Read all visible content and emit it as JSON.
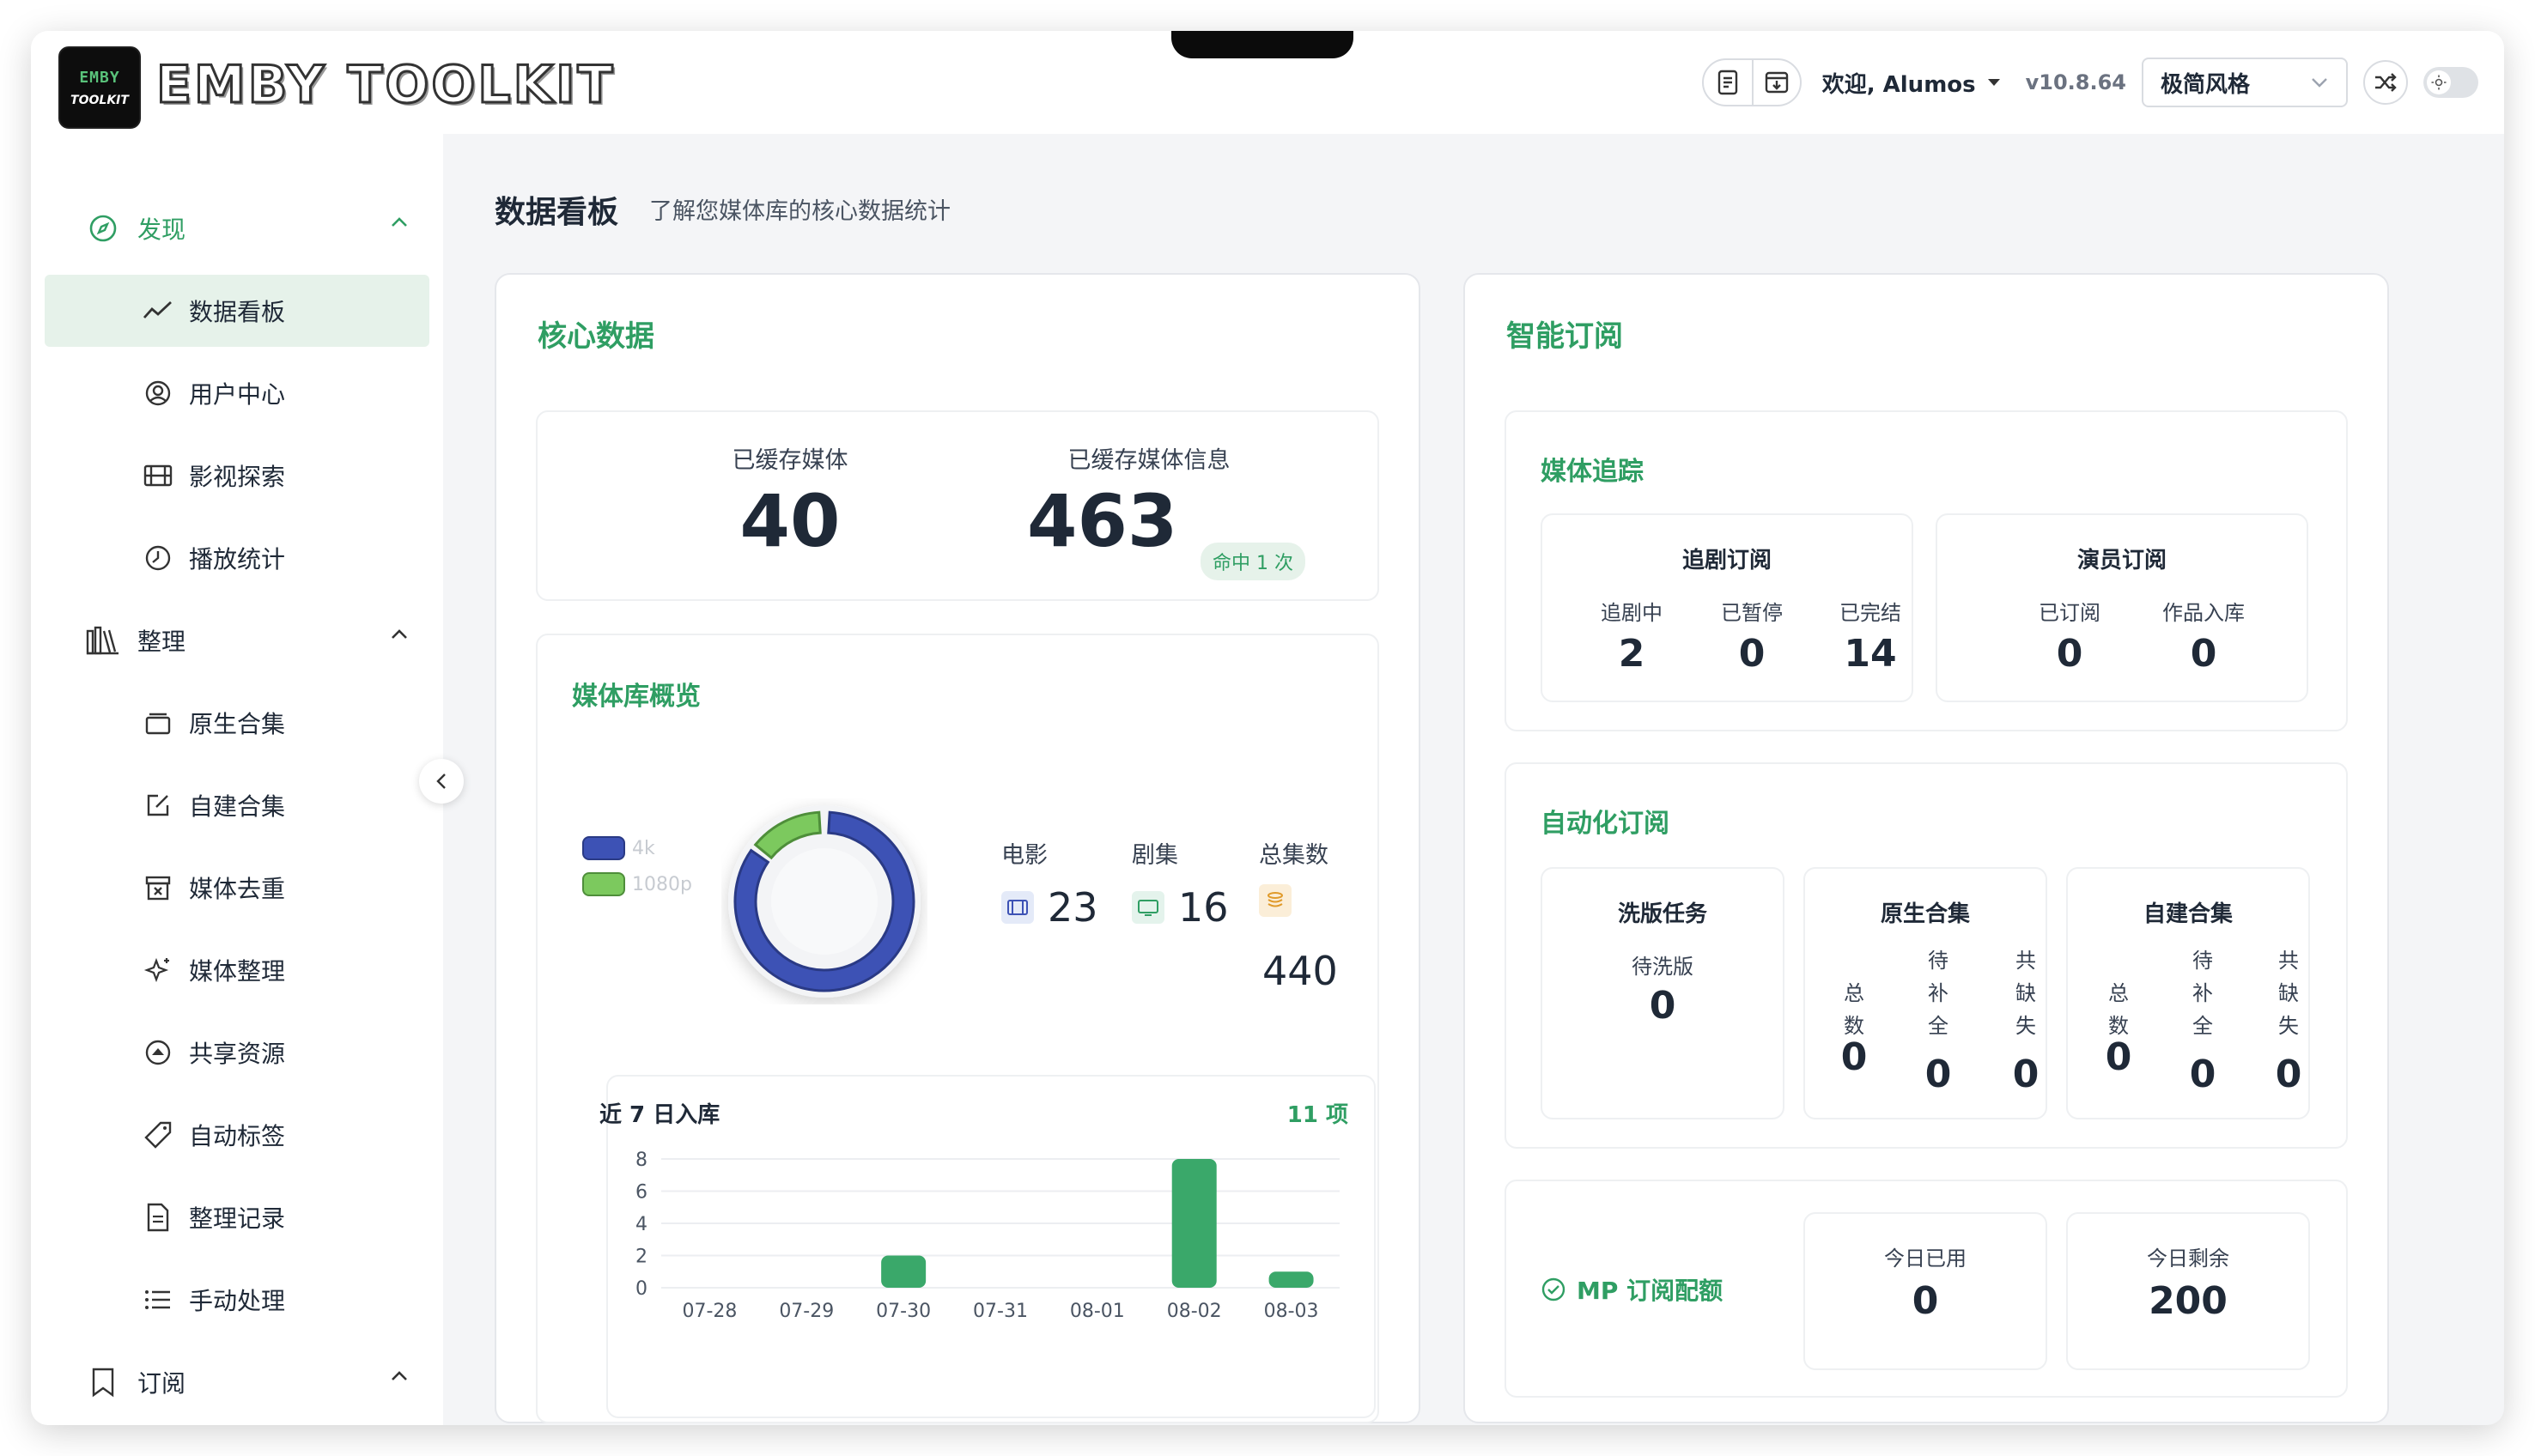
{
  "app": {
    "logo_top": "EMBY",
    "logo_bottom": "TOOLKIT",
    "brand": "EMBY TOOLKIT"
  },
  "header": {
    "welcome": "欢迎, Alumos",
    "version": "v10.8.64",
    "theme_value": "极简风格",
    "icons": [
      "doc-icon",
      "download-icon",
      "shuffle-icon",
      "sun-icon"
    ]
  },
  "sidebar": {
    "sections": [
      {
        "label": "发现",
        "icon": "compass-icon",
        "items": [
          {
            "label": "数据看板",
            "icon": "trend-icon",
            "active": true
          },
          {
            "label": "用户中心",
            "icon": "user-circle-icon"
          },
          {
            "label": "影视探索",
            "icon": "film-icon"
          },
          {
            "label": "播放统计",
            "icon": "clock-icon"
          }
        ]
      },
      {
        "label": "整理",
        "icon": "library-icon",
        "items": [
          {
            "label": "原生合集",
            "icon": "collection-icon"
          },
          {
            "label": "自建合集",
            "icon": "edit-icon"
          },
          {
            "label": "媒体去重",
            "icon": "dedupe-icon"
          },
          {
            "label": "媒体整理",
            "icon": "sparkle-icon"
          },
          {
            "label": "共享资源",
            "icon": "share-icon"
          },
          {
            "label": "自动标签",
            "icon": "tag-icon"
          },
          {
            "label": "整理记录",
            "icon": "file-icon"
          },
          {
            "label": "手动处理",
            "icon": "list-icon"
          }
        ]
      },
      {
        "label": "订阅",
        "icon": "bookmark-icon",
        "items": []
      }
    ]
  },
  "main": {
    "title": "数据看板",
    "subtitle": "了解您媒体库的核心数据统计",
    "core": {
      "title": "核心数据",
      "cached_media_label": "已缓存媒体",
      "cached_media_value": "40",
      "cached_info_label": "已缓存媒体信息",
      "cached_info_value": "463",
      "hit_badge": "命中 1 次"
    },
    "overview": {
      "title": "媒体库概览",
      "legend": [
        {
          "label": "4k",
          "color": "#3d52b5"
        },
        {
          "label": "1080p",
          "color": "#7cc95e"
        }
      ],
      "donut": {
        "4k": 85,
        "1080p": 15
      },
      "movies_label": "电影",
      "movies_value": "23",
      "series_label": "剧集",
      "series_value": "16",
      "episodes_label": "总集数",
      "episodes_value": "440"
    },
    "recent": {
      "title": "近 7 日入库",
      "count": "11 项"
    },
    "smart": {
      "title": "智能订阅",
      "tracking": {
        "title": "媒体追踪",
        "series_sub": {
          "title": "追剧订阅",
          "stats": [
            {
              "label": "追剧中",
              "value": "2"
            },
            {
              "label": "已暂停",
              "value": "0"
            },
            {
              "label": "已完结",
              "value": "14"
            }
          ]
        },
        "actor_sub": {
          "title": "演员订阅",
          "stats": [
            {
              "label": "已订阅",
              "value": "0"
            },
            {
              "label": "作品入库",
              "value": "0"
            }
          ]
        }
      },
      "auto": {
        "title": "自动化订阅",
        "washing": {
          "title": "洗版任务",
          "label": "待洗版",
          "value": "0"
        },
        "native": {
          "title": "原生合集",
          "stats": [
            {
              "label": "总数",
              "value": "0"
            },
            {
              "label": "待补全",
              "value": "0"
            },
            {
              "label": "共缺失",
              "value": "0"
            }
          ]
        },
        "custom": {
          "title": "自建合集",
          "stats": [
            {
              "label": "总数",
              "value": "0"
            },
            {
              "label": "待补全",
              "value": "0"
            },
            {
              "label": "共缺失",
              "value": "0"
            }
          ]
        }
      },
      "quota": {
        "title": "MP 订阅配额",
        "used_label": "今日已用",
        "used_value": "0",
        "left_label": "今日剩余",
        "left_value": "200"
      }
    }
  },
  "chart_data": {
    "type": "bar",
    "categories": [
      "07-28",
      "07-29",
      "07-30",
      "07-31",
      "08-01",
      "08-02",
      "08-03"
    ],
    "values": [
      0,
      0,
      2,
      0,
      0,
      8,
      1
    ],
    "yticks": [
      0,
      2,
      4,
      6,
      8
    ],
    "ylim": [
      0,
      8
    ],
    "color": "#3aa86a"
  }
}
